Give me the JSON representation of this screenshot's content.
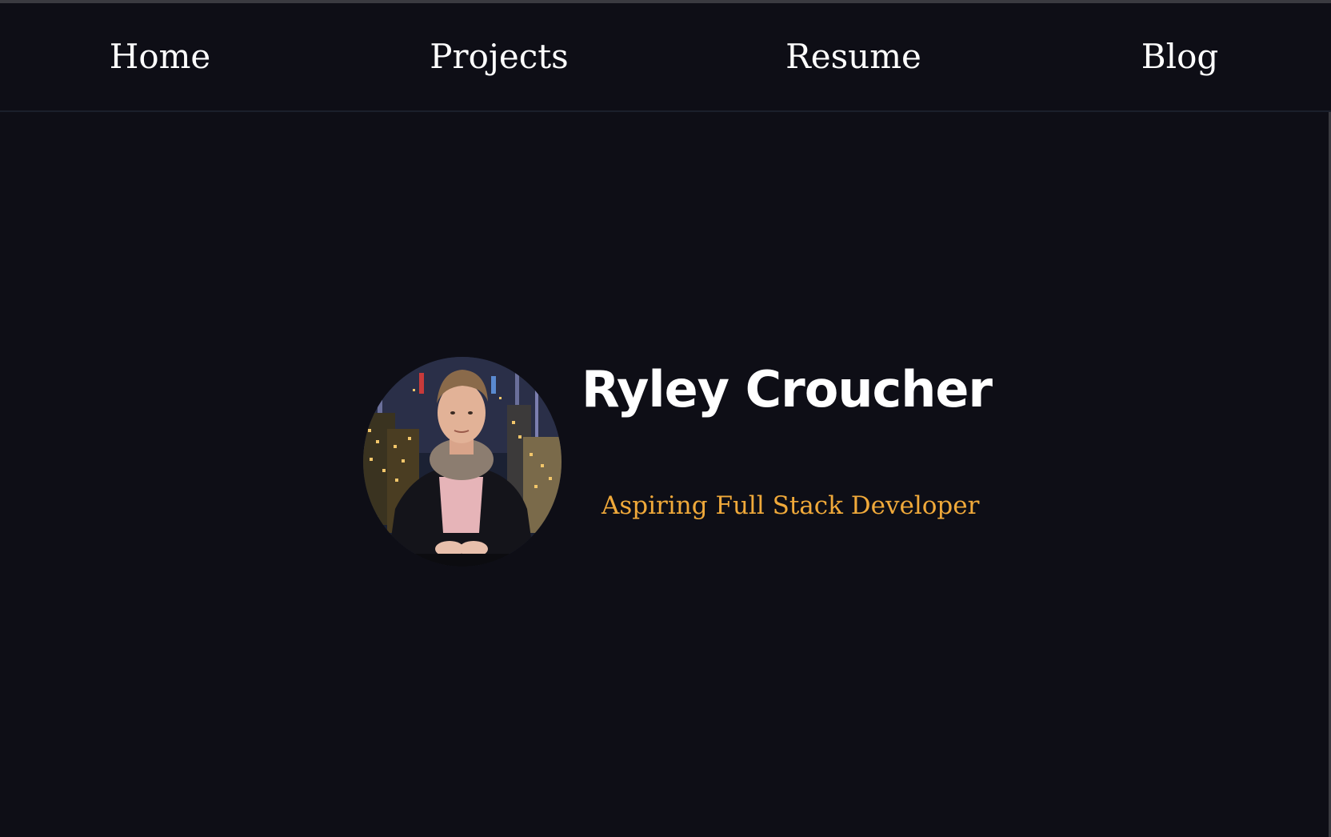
{
  "nav": {
    "home": "Home",
    "projects": "Projects",
    "resume": "Resume",
    "blog": "Blog"
  },
  "hero": {
    "name": "Ryley Croucher",
    "tagline": "Aspiring Full Stack Developer",
    "avatar_icon": "profile-photo"
  },
  "colors": {
    "background": "#0e0e16",
    "text": "#ffffff",
    "accent": "#f0a93a",
    "divider": "#1b1f2b"
  }
}
